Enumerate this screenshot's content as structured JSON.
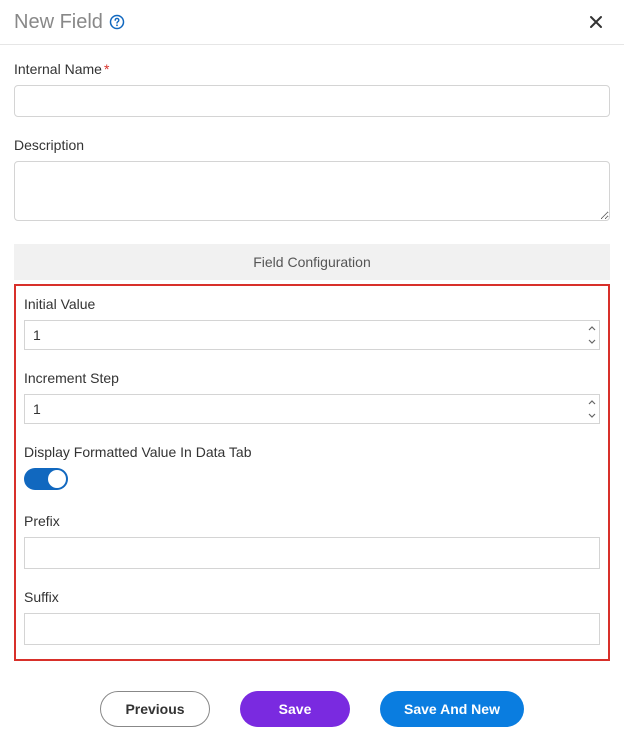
{
  "header": {
    "title": "New Field"
  },
  "form": {
    "internal_name_label": "Internal Name",
    "internal_name_value": "",
    "description_label": "Description",
    "description_value": "",
    "section_title": "Field Configuration",
    "initial_value_label": "Initial Value",
    "initial_value": "1",
    "increment_step_label": "Increment Step",
    "increment_step": "1",
    "display_formatted_label": "Display Formatted Value In Data Tab",
    "display_formatted_on": true,
    "prefix_label": "Prefix",
    "prefix_value": "",
    "suffix_label": "Suffix",
    "suffix_value": ""
  },
  "footer": {
    "previous": "Previous",
    "save": "Save",
    "save_and_new": "Save And New"
  }
}
